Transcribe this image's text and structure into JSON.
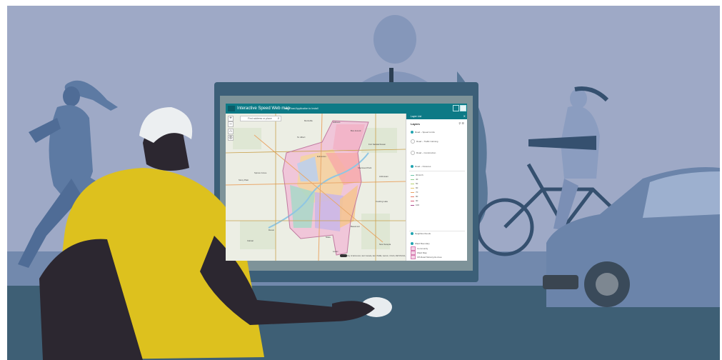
{
  "app": {
    "title": "Interactive Speed Web map",
    "subtitle": "with Road Application to Install"
  },
  "search": {
    "placeholder": "Find address or place"
  },
  "layer_panel": {
    "bar_title": "Layer List",
    "heading": "Layers",
    "rows": [
      "Road – Speed Limits",
      "Road – Traffic Calming",
      "Road – Construction",
      "Road – Closures",
      "Neighbourhoods",
      "Ward Boundary",
      "Community",
      "Ward Map",
      "Off-Road Motorcycle Area",
      "Public Pool"
    ],
    "legend": [
      "30 km/h",
      "40",
      "50",
      "60",
      "70",
      "80",
      "90",
      "100"
    ]
  },
  "map": {
    "labels": [
      "Edmonton",
      "St. Albert",
      "Sherwood Park",
      "Beaumont",
      "Spruce Grove",
      "Stony Plain",
      "Leduc",
      "Devon",
      "Fort Saskatchewan",
      "Morinville",
      "Gibbons",
      "Bon Accord",
      "Ardrossan",
      "Cooking Lake",
      "Nisku",
      "Calmar",
      "New Sarepta"
    ],
    "attribution": "City of Edmonton, Esri Canada, Esri, HERE, Garmin, USGS, METI/NASA, NRCan"
  },
  "colors": {
    "background": "#9ea9c6",
    "sidewalk": "#7289ad",
    "floor": "#3e5f75",
    "monitor_frame": "#3c5f78",
    "shirt": "#ddc11e",
    "skin": "#2c2730",
    "header": "#0d7a86"
  },
  "icons": [
    "zoom-in-icon",
    "zoom-out-icon",
    "home-icon",
    "locate-icon",
    "search-icon",
    "layers-icon",
    "basemap-icon"
  ]
}
